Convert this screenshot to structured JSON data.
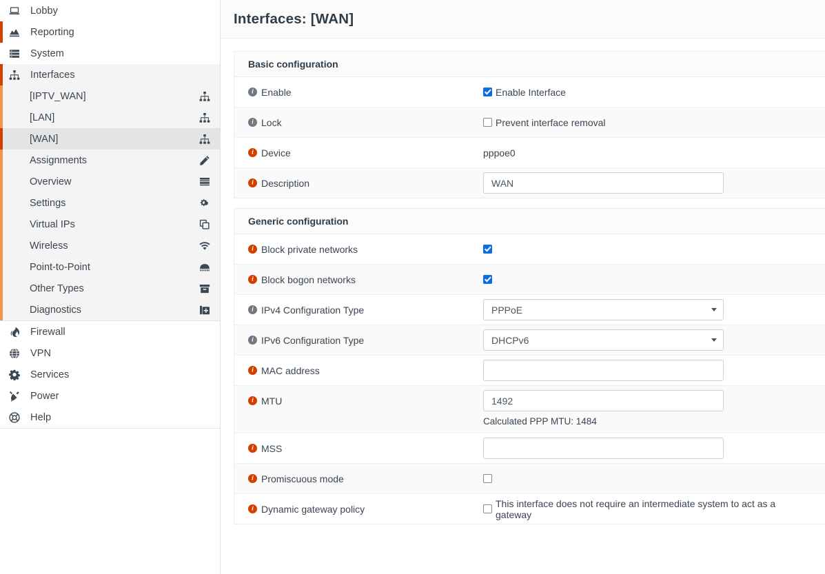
{
  "sidebar": {
    "top_items": [
      {
        "label": "Lobby",
        "icon": "laptop-icon",
        "accent": false,
        "active": false
      },
      {
        "label": "Reporting",
        "icon": "chart-area-icon",
        "accent": true,
        "active": false
      },
      {
        "label": "System",
        "icon": "server-icon",
        "accent": false,
        "active": false
      },
      {
        "label": "Interfaces",
        "icon": "sitemap-icon",
        "accent": true,
        "active": true
      }
    ],
    "submenu_items": [
      {
        "label": "[IPTV_WAN]",
        "icon": "sitemap-icon",
        "selected": false
      },
      {
        "label": "[LAN]",
        "icon": "sitemap-icon",
        "selected": false
      },
      {
        "label": "[WAN]",
        "icon": "sitemap-icon",
        "selected": true
      },
      {
        "label": "Assignments",
        "icon": "pencil-icon",
        "selected": false
      },
      {
        "label": "Overview",
        "icon": "list-icon",
        "selected": false
      },
      {
        "label": "Settings",
        "icon": "gears-icon",
        "selected": false
      },
      {
        "label": "Virtual IPs",
        "icon": "copy-icon",
        "selected": false
      },
      {
        "label": "Wireless",
        "icon": "wifi-icon",
        "selected": false
      },
      {
        "label": "Point-to-Point",
        "icon": "modem-icon",
        "selected": false
      },
      {
        "label": "Other Types",
        "icon": "archive-icon",
        "selected": false
      },
      {
        "label": "Diagnostics",
        "icon": "medical-case-icon",
        "selected": false
      }
    ],
    "bottom_items": [
      {
        "label": "Firewall",
        "icon": "fire-icon",
        "accent": false,
        "active": false
      },
      {
        "label": "VPN",
        "icon": "globe-icon",
        "accent": false,
        "active": false
      },
      {
        "label": "Services",
        "icon": "gear-icon",
        "accent": false,
        "active": false
      },
      {
        "label": "Power",
        "icon": "plug-icon",
        "accent": false,
        "active": false
      },
      {
        "label": "Help",
        "icon": "lifering-icon",
        "accent": false,
        "active": false
      }
    ]
  },
  "header": {
    "title": "Interfaces: [WAN]"
  },
  "colors": {
    "accent_dark": "#d14000",
    "accent_light": "#f3944d",
    "checkbox_blue": "#0b6ee0",
    "info_gray": "#707883"
  },
  "basic_configuration": {
    "title": "Basic configuration",
    "rows": [
      {
        "label": "Enable",
        "icon_color": "gray",
        "type": "checkbox",
        "checked": true,
        "checkbox_label": "Enable Interface"
      },
      {
        "label": "Lock",
        "icon_color": "gray",
        "type": "checkbox",
        "checked": false,
        "checkbox_label": "Prevent interface removal"
      },
      {
        "label": "Device",
        "icon_color": "orange",
        "type": "text",
        "value": "pppoe0"
      },
      {
        "label": "Description",
        "icon_color": "orange",
        "type": "input",
        "value": "WAN",
        "placeholder": ""
      }
    ]
  },
  "generic_configuration": {
    "title": "Generic configuration",
    "rows": [
      {
        "label": "Block private networks",
        "icon_color": "orange",
        "type": "checkbox",
        "checked": true,
        "checkbox_label": ""
      },
      {
        "label": "Block bogon networks",
        "icon_color": "orange",
        "type": "checkbox",
        "checked": true,
        "checkbox_label": ""
      },
      {
        "label": "IPv4 Configuration Type",
        "icon_color": "gray",
        "type": "select",
        "value": "PPPoE"
      },
      {
        "label": "IPv6 Configuration Type",
        "icon_color": "gray",
        "type": "select",
        "value": "DHCPv6"
      },
      {
        "label": "MAC address",
        "icon_color": "orange",
        "type": "input",
        "value": "",
        "placeholder": ""
      },
      {
        "label": "MTU",
        "icon_color": "orange",
        "type": "input",
        "value": "1492",
        "placeholder": "",
        "helper": "Calculated PPP MTU: 1484"
      },
      {
        "label": "MSS",
        "icon_color": "orange",
        "type": "input",
        "value": "",
        "placeholder": ""
      },
      {
        "label": "Promiscuous mode",
        "icon_color": "orange",
        "type": "checkbox",
        "checked": false,
        "checkbox_label": ""
      },
      {
        "label": "Dynamic gateway policy",
        "icon_color": "orange",
        "type": "checkbox",
        "checked": false,
        "checkbox_label": "This interface does not require an intermediate system to act as a gateway"
      }
    ]
  }
}
